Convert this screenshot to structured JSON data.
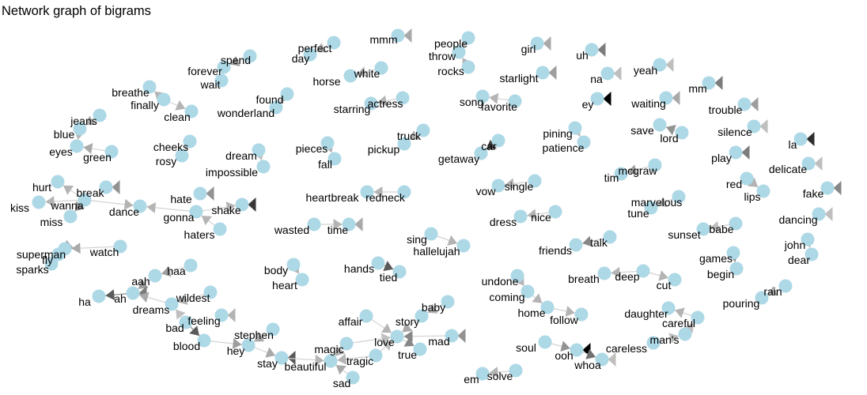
{
  "title": "Network graph of bigrams",
  "node_color": "#add8e6",
  "edges": [
    [
      "spend",
      "forever",
      0.3
    ],
    [
      "wait",
      "forever",
      0.3
    ],
    [
      "finally",
      "breathe",
      0.2
    ],
    [
      "finally",
      "clean",
      0.2
    ],
    [
      "found",
      "wonderland",
      0.2
    ],
    [
      "perfect",
      "day",
      0.2
    ],
    [
      "mmm",
      "mmm",
      0.25
    ],
    [
      "white",
      "horse",
      0.2
    ],
    [
      "people",
      "throw",
      0.2
    ],
    [
      "rocks",
      "throw",
      0.2
    ],
    [
      "girl",
      "girl",
      0.25
    ],
    [
      "uh",
      "uh",
      0.45
    ],
    [
      "yeah",
      "yeah",
      0.15
    ],
    [
      "na",
      "na",
      0.15
    ],
    [
      "favorite",
      "song",
      0.2
    ],
    [
      "actress",
      "starring",
      0.2
    ],
    [
      "starlight",
      "starlight",
      0.3
    ],
    [
      "ey",
      "ey",
      1.0
    ],
    [
      "mm",
      "mm",
      0.45
    ],
    [
      "waiting",
      "waiting",
      0.25
    ],
    [
      "trouble",
      "trouble",
      0.3
    ],
    [
      "lord",
      "save",
      0.35
    ],
    [
      "silence",
      "silence",
      0.15
    ],
    [
      "la",
      "la",
      0.8
    ],
    [
      "jeans",
      "blue",
      0.2
    ],
    [
      "blue",
      "eyes",
      0.2
    ],
    [
      "green",
      "eyes",
      0.25
    ],
    [
      "cheeks",
      "rosy",
      0.2
    ],
    [
      "dream",
      "impossible",
      0.15
    ],
    [
      "pieces",
      "fall",
      0.2
    ],
    [
      "truck",
      "pickup",
      0.2
    ],
    [
      "car",
      "getaway",
      0.7
    ],
    [
      "pining",
      "patience",
      0.15
    ],
    [
      "play",
      "play",
      0.45
    ],
    [
      "delicate",
      "delicate",
      0.15
    ],
    [
      "mcgraw",
      "tim",
      0.3
    ],
    [
      "red",
      "lips",
      0.2
    ],
    [
      "fake",
      "fake",
      0.4
    ],
    [
      "wanna",
      "hurt",
      0.2
    ],
    [
      "wanna",
      "kiss",
      0.2
    ],
    [
      "wanna",
      "miss",
      0.35
    ],
    [
      "break",
      "break",
      0.35
    ],
    [
      "wanna",
      "dance",
      0.2
    ],
    [
      "gonna",
      "dance",
      0.2
    ],
    [
      "hate",
      "hate",
      0.35
    ],
    [
      "gonna",
      "shake",
      0.2
    ],
    [
      "shake",
      "shake",
      0.75
    ],
    [
      "haters",
      "gonna",
      0.2
    ],
    [
      "redneck",
      "heartbreak",
      0.2
    ],
    [
      "single",
      "vow",
      0.2
    ],
    [
      "marvelous",
      "tune",
      0.2
    ],
    [
      "wasted",
      "time",
      0.2
    ],
    [
      "time",
      "time",
      0.25
    ],
    [
      "nice",
      "dress",
      0.2
    ],
    [
      "dancing",
      "dancing",
      0.15
    ],
    [
      "watch",
      "superman",
      0.25
    ],
    [
      "superman",
      "fly",
      0.3
    ],
    [
      "fly",
      "sparks",
      0.3
    ],
    [
      "talk",
      "friends",
      0.4
    ],
    [
      "sing",
      "hallelujah",
      0.2
    ],
    [
      "babe",
      "sunset",
      0.15
    ],
    [
      "john",
      "dear",
      0.15
    ],
    [
      "haa",
      "aah",
      0.3
    ],
    [
      "aah",
      "ah",
      0.3
    ],
    [
      "ah",
      "ha",
      0.6
    ],
    [
      "ah",
      "ah",
      0.45
    ],
    [
      "dreams",
      "ah",
      0.25
    ],
    [
      "wildest",
      "dreams",
      0.2
    ],
    [
      "bad",
      "dreams",
      0.15
    ],
    [
      "body",
      "heart",
      0.2
    ],
    [
      "hands",
      "tied",
      0.6
    ],
    [
      "games",
      "begin",
      0.4
    ],
    [
      "deep",
      "breath",
      0.2
    ],
    [
      "deep",
      "cut",
      0.2
    ],
    [
      "rain",
      "pouring",
      0.2
    ],
    [
      "undone",
      "coming",
      0.2
    ],
    [
      "coming",
      "home",
      0.2
    ],
    [
      "home",
      "follow",
      0.2
    ],
    [
      "feeling",
      "feeling",
      0.2
    ],
    [
      "bad",
      "blood",
      0.6
    ],
    [
      "blood",
      "hey",
      0.3
    ],
    [
      "stephen",
      "hey",
      0.25
    ],
    [
      "hey",
      "stay",
      0.25
    ],
    [
      "stay",
      "stay",
      0.6
    ],
    [
      "stay",
      "beautiful",
      0.2
    ],
    [
      "magic",
      "beautiful",
      0.2
    ],
    [
      "tragic",
      "beautiful",
      0.2
    ],
    [
      "sad",
      "beautiful",
      0.25
    ],
    [
      "affair",
      "love",
      0.2
    ],
    [
      "magic",
      "love",
      0.15
    ],
    [
      "tragic",
      "love",
      0.15
    ],
    [
      "story",
      "love",
      0.25
    ],
    [
      "baby",
      "story",
      0.2
    ],
    [
      "mad",
      "love",
      0.4
    ],
    [
      "mad",
      "mad",
      0.35
    ],
    [
      "love",
      "true",
      0.4
    ],
    [
      "careful",
      "daughter",
      0.2
    ],
    [
      "mans",
      "careful",
      0.15
    ],
    [
      "careless",
      "mans",
      0.15
    ],
    [
      "soul",
      "ooh",
      0.35
    ],
    [
      "ooh",
      "ooh",
      1.0
    ],
    [
      "ooh",
      "whoa",
      0.5
    ],
    [
      "whoa",
      "whoa",
      0.15
    ],
    [
      "solve",
      "em",
      0.2
    ]
  ],
  "nodes": {
    "spend": "spend",
    "forever": "forever",
    "wait": "wait",
    "perfect": "perfect",
    "day": "day",
    "mmm": "mmm",
    "people": "people",
    "throw": "throw",
    "rocks": "rocks",
    "girl": "girl",
    "uh": "uh",
    "breathe": "breathe",
    "finally": "finally",
    "clean": "clean",
    "found": "found",
    "wonderland": "wonderland",
    "horse": "horse",
    "white": "white",
    "starring": "starring",
    "actress": "actress",
    "song": "song",
    "favorite": "favorite",
    "starlight": "starlight",
    "na": "na",
    "yeah": "yeah",
    "ey": "ey",
    "waiting": "waiting",
    "mm": "mm",
    "trouble": "trouble",
    "jeans": "jeans",
    "blue": "blue",
    "eyes": "eyes",
    "green": "green",
    "cheeks": "cheeks",
    "rosy": "rosy",
    "dream": "dream",
    "impossible": "impossible",
    "pieces": "pieces",
    "fall": "fall",
    "truck": "truck",
    "pickup": "pickup",
    "getaway": "getaway",
    "car": "car",
    "pining": "pining",
    "patience": "patience",
    "save": "save",
    "lord": "lord",
    "silence": "silence",
    "la": "la",
    "play": "play",
    "delicate": "delicate",
    "tim": "tim",
    "mcgraw": "mcgraw",
    "red": "red",
    "lips": "lips",
    "fake": "fake",
    "hurt": "hurt",
    "break": "break",
    "kiss": "kiss",
    "wanna": "wanna",
    "miss": "miss",
    "dance": "dance",
    "hate": "hate",
    "gonna": "gonna",
    "shake": "shake",
    "haters": "haters",
    "heartbreak": "heartbreak",
    "redneck": "redneck",
    "vow": "vow",
    "single": "single",
    "marvelous": "marvelous",
    "tune": "tune",
    "wasted": "wasted",
    "time": "time",
    "dress": "dress",
    "nice": "nice",
    "sunset": "sunset",
    "babe": "babe",
    "dancing": "dancing",
    "superman": "superman",
    "fly": "fly",
    "watch": "watch",
    "sparks": "sparks",
    "sing": "sing",
    "hallelujah": "hallelujah",
    "friends": "friends",
    "talk": "talk",
    "john": "john",
    "dear": "dear",
    "games": "games",
    "begin": "begin",
    "haa": "haa",
    "aah": "aah",
    "ha": "ha",
    "ah": "ah",
    "wildest": "wildest",
    "dreams": "dreams",
    "body": "body",
    "heart": "heart",
    "hands": "hands",
    "tied": "tied",
    "undone": "undone",
    "coming": "coming",
    "home": "home",
    "follow": "follow",
    "breath": "breath",
    "deep": "deep",
    "cut": "cut",
    "rain": "rain",
    "pouring": "pouring",
    "bad": "bad",
    "feeling": "feeling",
    "blood": "blood",
    "stephen": "stephen",
    "hey": "hey",
    "stay": "stay",
    "beautiful": "beautiful",
    "magic": "magic",
    "tragic": "tragic",
    "sad": "sad",
    "affair": "affair",
    "love": "love",
    "story": "story",
    "baby": "baby",
    "mad": "mad",
    "true": "true",
    "daughter": "daughter",
    "careful": "careful",
    "mans": "man's",
    "careless": "careless",
    "soul": "soul",
    "ooh": "ooh",
    "whoa": "whoa",
    "em": "em",
    "solve": "solve"
  }
}
